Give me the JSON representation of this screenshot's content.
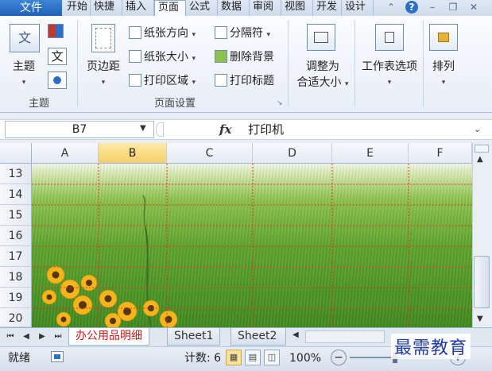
{
  "ribbon_tabs": [
    {
      "label": "文件",
      "active": false
    },
    {
      "label": "开始"
    },
    {
      "label": "快捷"
    },
    {
      "label": "插入"
    },
    {
      "label": "页面",
      "active": true
    },
    {
      "label": "公式"
    },
    {
      "label": "数据"
    },
    {
      "label": "审阅"
    },
    {
      "label": "视图"
    },
    {
      "label": "开发"
    },
    {
      "label": "设计"
    }
  ],
  "ribbon": {
    "theme_group": {
      "label": "主题",
      "theme_btn": "主题"
    },
    "page_setup": {
      "label": "页面设置",
      "margins_btn": "页边距",
      "orientation": "纸张方向",
      "size": "纸张大小",
      "print_area": "打印区域",
      "breaks": "分隔符",
      "background": "删除背景",
      "print_titles": "打印标题"
    },
    "scale_group": {
      "label_line1": "调整为",
      "label_line2": "合适大小"
    },
    "sheet_options": {
      "label": "工作表选项"
    },
    "arrange": {
      "label": "排列"
    }
  },
  "formula_bar": {
    "name_box": "B7",
    "fx": "fx",
    "content": "打印机"
  },
  "grid": {
    "columns": [
      "A",
      "B",
      "C",
      "D",
      "E",
      "F"
    ],
    "selected_column": "B",
    "rows": [
      "13",
      "14",
      "15",
      "16",
      "17",
      "18",
      "19",
      "20"
    ]
  },
  "sheet_tabs": [
    {
      "label": "办公用品明细",
      "active": true
    },
    {
      "label": "Sheet1"
    },
    {
      "label": "Sheet2"
    }
  ],
  "status_bar": {
    "ready": "就绪",
    "count": "计数: 6",
    "zoom": "100%",
    "zoom_minus": "−",
    "zoom_plus": "+"
  },
  "watermark": "最需教育",
  "colors": {
    "accent": "#1f62b7",
    "selected_header": "#f6cf6a",
    "page_break": "#e03a1e",
    "active_sheet_text": "#d01b1b"
  }
}
